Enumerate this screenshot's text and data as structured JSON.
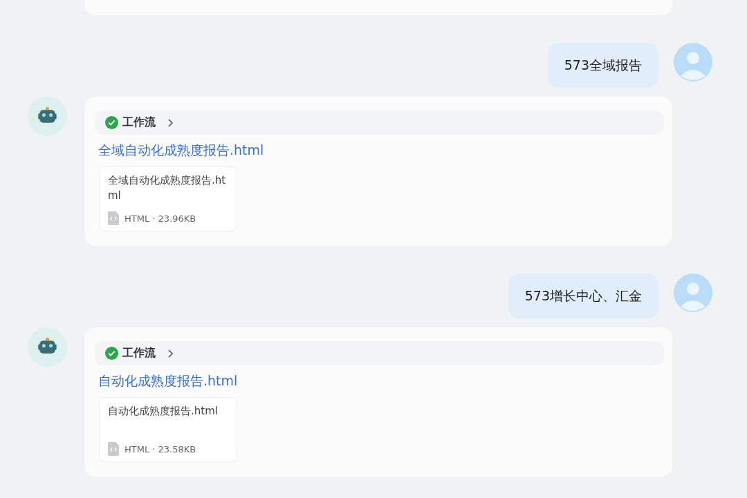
{
  "messages": [
    {
      "kind": "user",
      "text": "573全域报告"
    },
    {
      "kind": "bot",
      "workflow": {
        "label": "工作流",
        "done": true
      },
      "link": "全域自动化成熟度报告.html",
      "file": {
        "name": "全域自动化成熟度报告.html",
        "meta": "HTML · 23.96KB"
      }
    },
    {
      "kind": "user",
      "text": "573增长中心、汇金"
    },
    {
      "kind": "bot",
      "workflow": {
        "label": "工作流",
        "done": true
      },
      "link": "自动化成熟度报告.html",
      "file": {
        "name": "自动化成熟度报告.html",
        "meta": "HTML · 23.58KB"
      }
    }
  ]
}
